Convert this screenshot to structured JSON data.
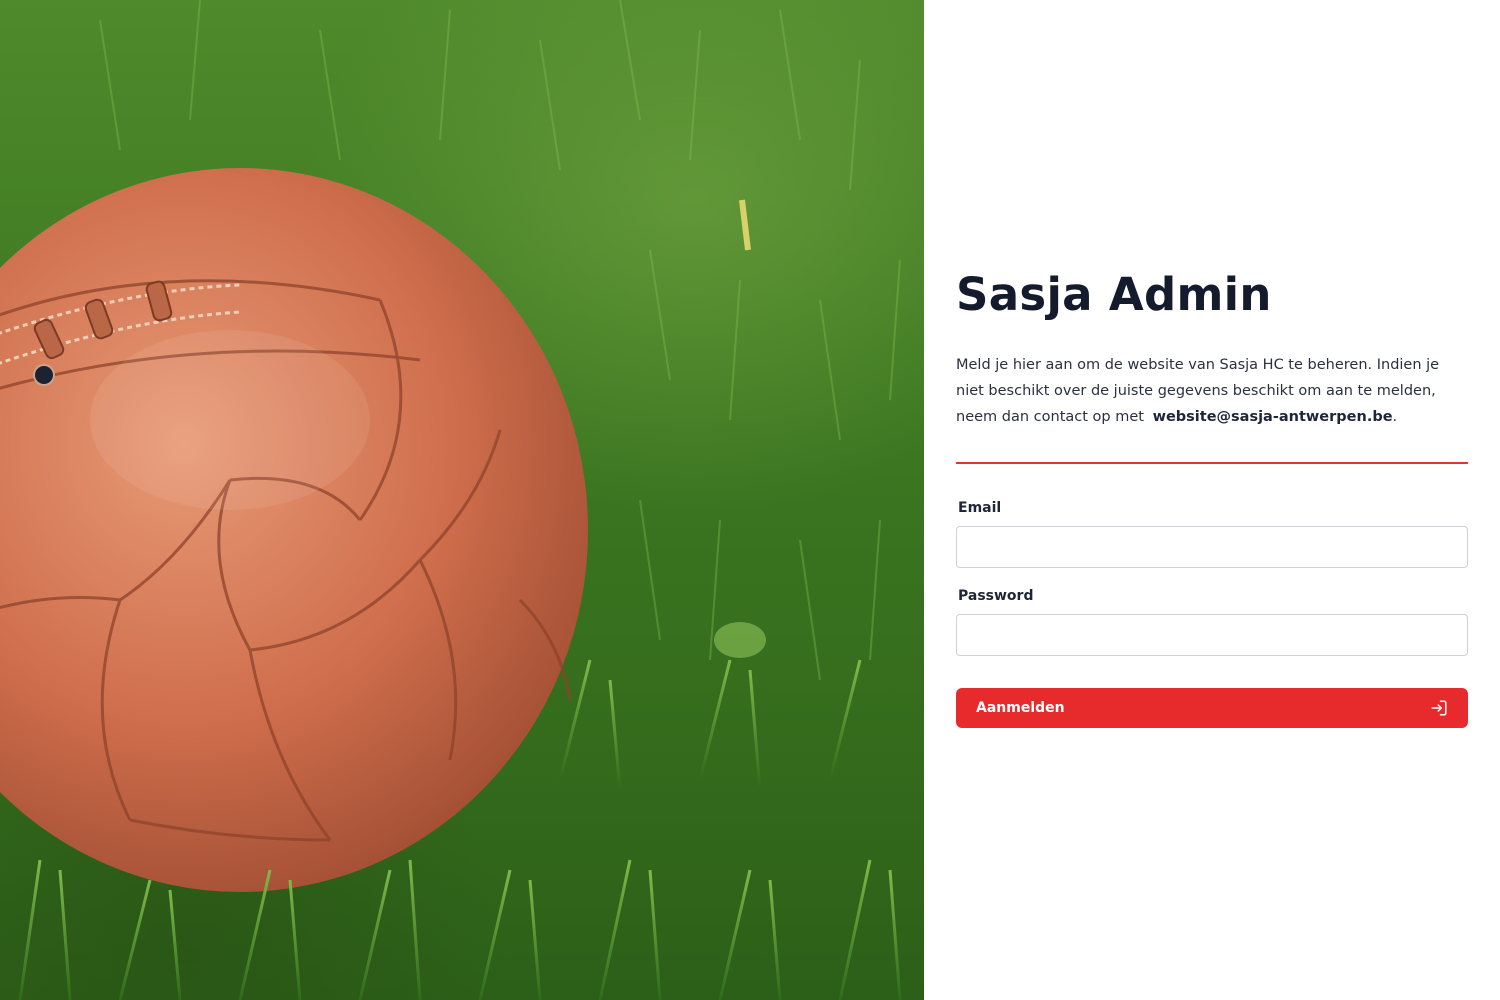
{
  "hero": {
    "image_alt": "leather-football-on-grass"
  },
  "login": {
    "title": "Sasja Admin",
    "intro_text": "Meld je hier aan om de website van Sasja HC te beheren. Indien je niet beschikt over de juiste gegevens beschikt om aan te melden, neem dan contact op met",
    "contact_email": "website@sasja-antwerpen.be",
    "intro_end": ".",
    "email_label": "Email",
    "email_value": "",
    "password_label": "Password",
    "password_value": "",
    "submit_label": "Aanmelden",
    "submit_icon": "login-icon"
  },
  "colors": {
    "accent": "#e72b2d",
    "title": "#141b2d",
    "text": "#2b3040",
    "input_border": "#cfd3d9"
  }
}
